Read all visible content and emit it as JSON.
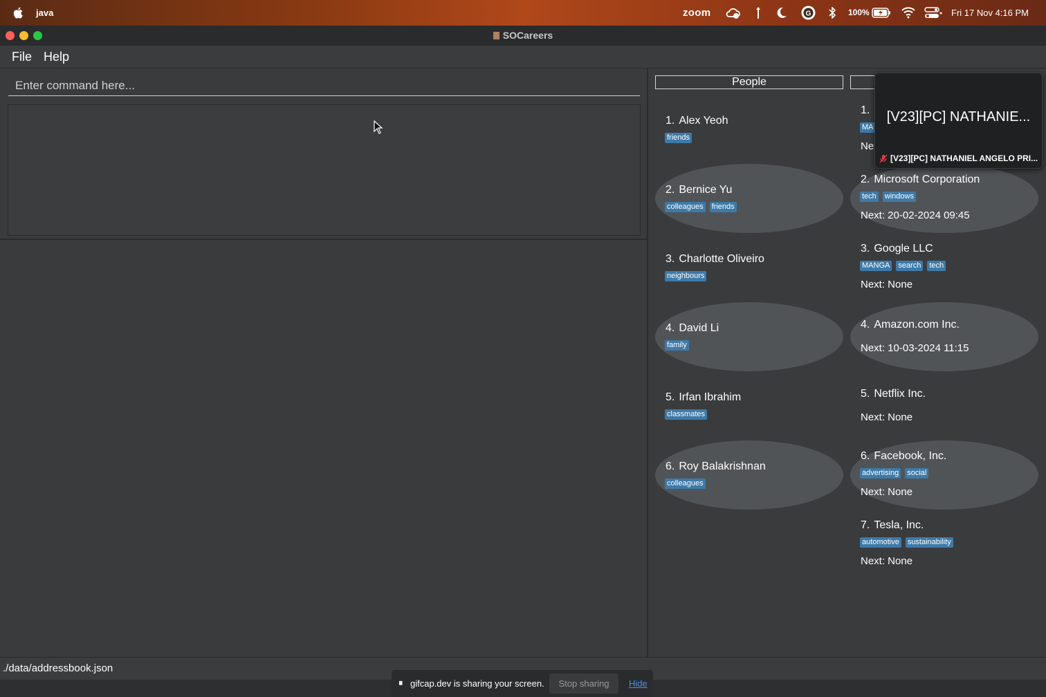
{
  "menubar": {
    "app_name": "java",
    "zoom_label": "zoom",
    "battery": "100%",
    "datetime": "Fri 17 Nov  4:16 PM"
  },
  "window": {
    "title": "SOCareers"
  },
  "menu": {
    "file": "File",
    "help": "Help"
  },
  "command": {
    "placeholder": "Enter command here..."
  },
  "people": {
    "header": "People",
    "items": [
      {
        "index": "1.",
        "name": "Alex Yeoh",
        "tags": [
          "friends"
        ]
      },
      {
        "index": "2.",
        "name": "Bernice Yu",
        "tags": [
          "colleagues",
          "friends"
        ]
      },
      {
        "index": "3.",
        "name": "Charlotte Oliveiro",
        "tags": [
          "neighbours"
        ]
      },
      {
        "index": "4.",
        "name": "David Li",
        "tags": [
          "family"
        ]
      },
      {
        "index": "5.",
        "name": "Irfan Ibrahim",
        "tags": [
          "classmates"
        ]
      },
      {
        "index": "6.",
        "name": "Roy Balakrishnan",
        "tags": [
          "colleagues"
        ]
      }
    ]
  },
  "companies": {
    "items": [
      {
        "index": "1.",
        "name": "",
        "tags": [
          "MA"
        ],
        "next": "Next: 15-12-2023 14:30"
      },
      {
        "index": "2.",
        "name": "Microsoft Corporation",
        "tags": [
          "tech",
          "windows"
        ],
        "next": "Next: 20-02-2024 09:45"
      },
      {
        "index": "3.",
        "name": "Google LLC",
        "tags": [
          "MANGA",
          "search",
          "tech"
        ],
        "next": "Next: None"
      },
      {
        "index": "4.",
        "name": "Amazon.com Inc.",
        "tags": [],
        "next": "Next: 10-03-2024 11:15"
      },
      {
        "index": "5.",
        "name": "Netflix Inc.",
        "tags": [],
        "next": "Next: None"
      },
      {
        "index": "6.",
        "name": "Facebook, Inc.",
        "tags": [
          "advertising",
          "social"
        ],
        "next": "Next: None"
      },
      {
        "index": "7.",
        "name": "Tesla, Inc.",
        "tags": [
          "automotive",
          "sustainability"
        ],
        "next": "Next: None"
      }
    ]
  },
  "status": {
    "path": "./data/addressbook.json"
  },
  "zoom_overlay": {
    "title": "[V23][PC] NATHANIE...",
    "subtitle": "[V23][PC] NATHANIEL ANGELO PRI..."
  },
  "sharing": {
    "message": "gifcap.dev is sharing your screen.",
    "stop": "Stop sharing",
    "hide": "Hide"
  },
  "colors": {
    "tag": "#3e7aa8",
    "card_light": "#515457",
    "card_dark": "#3a3b3d",
    "close": "#fe5f57",
    "minimize": "#febc2e",
    "maximize": "#28c840",
    "hide_link": "#4a90e2"
  }
}
